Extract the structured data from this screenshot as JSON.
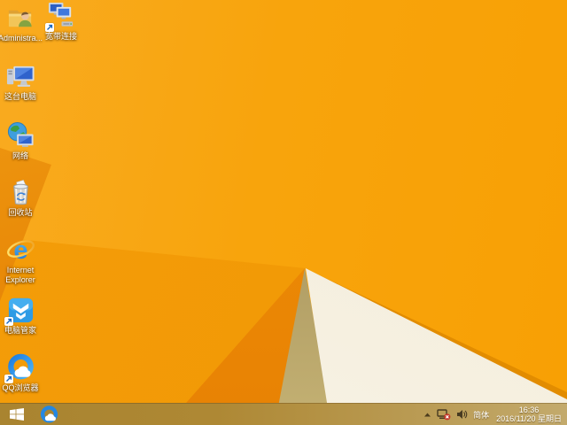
{
  "desktop": {
    "icons": [
      {
        "name": "administrator-folder",
        "label": "Administra..."
      },
      {
        "name": "broadband-connection",
        "label": "宽带连接"
      },
      {
        "name": "this-pc",
        "label": "这台电脑"
      },
      {
        "name": "network",
        "label": "网络"
      },
      {
        "name": "recycle-bin",
        "label": "回收站"
      },
      {
        "name": "internet-explorer",
        "label": "Internet Explorer"
      },
      {
        "name": "pc-manager",
        "label": "电脑管家"
      },
      {
        "name": "qq-browser",
        "label": "QQ浏览器"
      }
    ]
  },
  "taskbar": {
    "tray": {
      "input_method_label": "简体",
      "time": "16:36",
      "date": "2016/11/20 星期日"
    }
  },
  "colors": {
    "wallpaper_orange": "#F8A40C",
    "wallpaper_dark_orange": "#E88204",
    "wallpaper_tan": "#A8955E",
    "wallpaper_cream": "#F5EFDF",
    "taskbar_left": "#A98430",
    "taskbar_right": "#C3AA6C",
    "network_error_badge": "#C5382B"
  }
}
